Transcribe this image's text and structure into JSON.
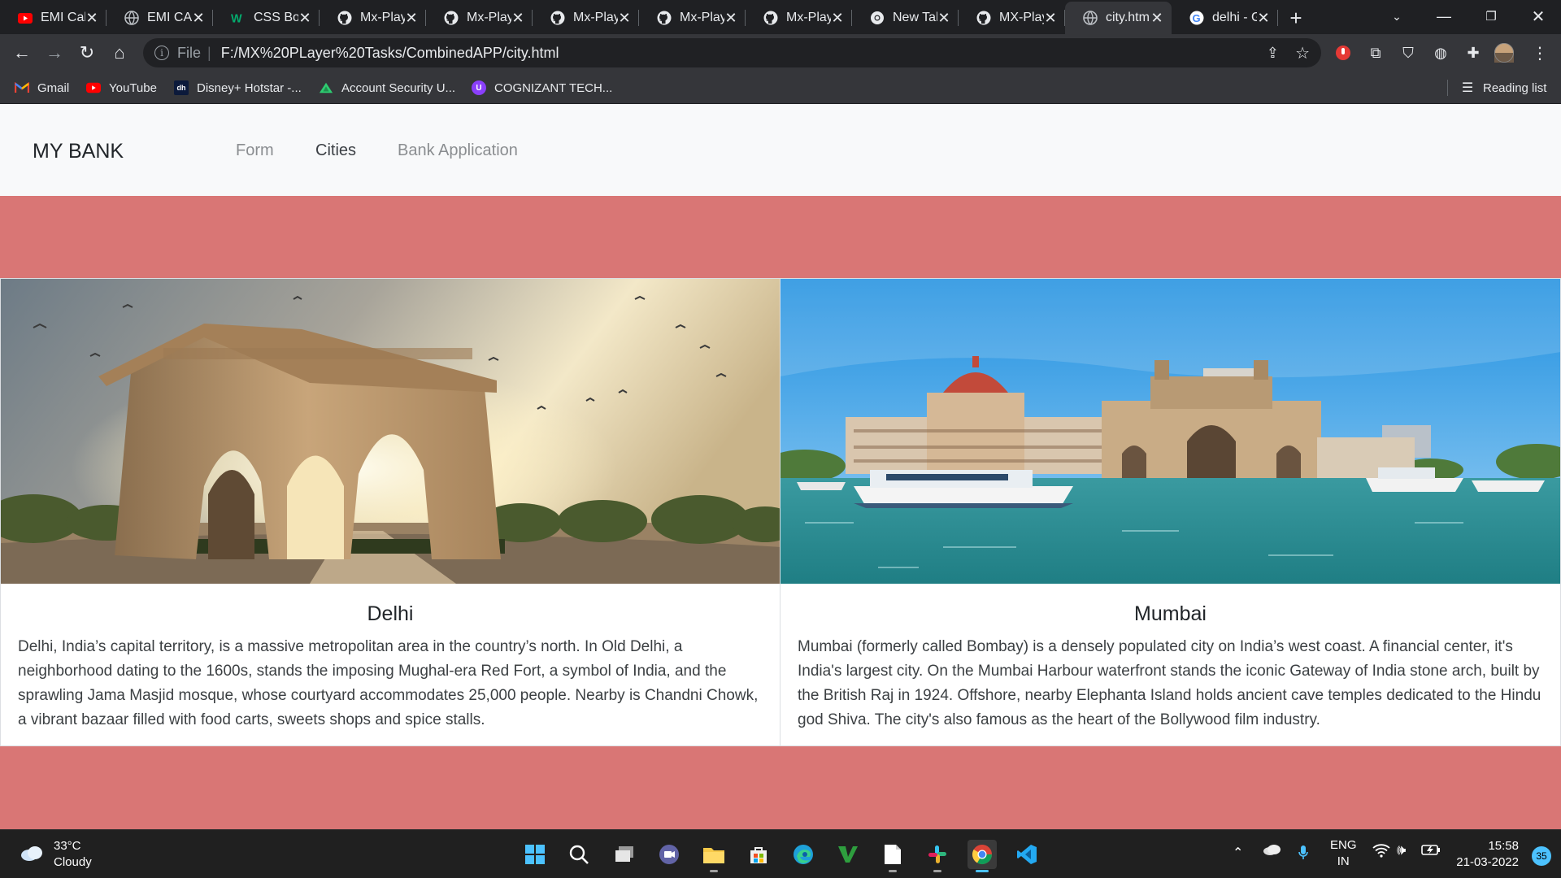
{
  "browser": {
    "tabs": [
      {
        "title": "EMI Cal",
        "icon": "youtube-icon"
      },
      {
        "title": "EMI CA",
        "icon": "globe-icon"
      },
      {
        "title": "CSS Box",
        "icon": "w3schools-icon"
      },
      {
        "title": "Mx-Play",
        "icon": "github-icon"
      },
      {
        "title": "Mx-Play",
        "icon": "github-icon"
      },
      {
        "title": "Mx-Play",
        "icon": "github-icon"
      },
      {
        "title": "Mx-Play",
        "icon": "github-icon"
      },
      {
        "title": "Mx-Play",
        "icon": "github-icon"
      },
      {
        "title": "New Tab",
        "icon": "chrome-icon"
      },
      {
        "title": "MX-Play",
        "icon": "github-icon"
      },
      {
        "title": "city.htm",
        "icon": "globe-icon",
        "active": true
      },
      {
        "title": "delhi - G",
        "icon": "google-icon"
      }
    ],
    "address": {
      "scheme": "File",
      "url": "F:/MX%20PLayer%20Tasks/CombinedAPP/city.html"
    },
    "bookmarks": [
      {
        "label": "Gmail",
        "icon": "gmail-icon"
      },
      {
        "label": "YouTube",
        "icon": "youtube-icon"
      },
      {
        "label": "Disney+ Hotstar -...",
        "icon": "hotstar-icon"
      },
      {
        "label": "Account Security U...",
        "icon": "triangle-icon"
      },
      {
        "label": "COGNIZANT TECH...",
        "icon": "cognizant-icon"
      }
    ],
    "reading_list": "Reading list"
  },
  "site": {
    "brand": "MY BANK",
    "nav": [
      {
        "label": "Form",
        "active": false
      },
      {
        "label": "Cities",
        "active": true
      },
      {
        "label": "Bank Application",
        "active": false
      }
    ],
    "background_color": "#d97675"
  },
  "cards": [
    {
      "title": "Delhi",
      "image": "india-gate-photo",
      "text": "Delhi, India’s capital territory, is a massive metropolitan area in the country’s north. In Old Delhi, a neighborhood dating to the 1600s, stands the imposing Mughal-era Red Fort, a symbol of India, and the sprawling Jama Masjid mosque, whose courtyard accommodates 25,000 people. Nearby is Chandni Chowk, a vibrant bazaar filled with food carts, sweets shops and spice stalls."
    },
    {
      "title": "Mumbai",
      "image": "gateway-of-india-photo",
      "text": "Mumbai (formerly called Bombay) is a densely populated city on India’s west coast. A financial center, it's India's largest city. On the Mumbai Harbour waterfront stands the iconic Gateway of India stone arch, built by the British Raj in 1924. Offshore, nearby Elephanta Island holds ancient cave temples dedicated to the Hindu god Shiva. The city's also famous as the heart of the Bollywood film industry."
    }
  ],
  "taskbar": {
    "weather": {
      "temp": "33°C",
      "condition": "Cloudy"
    },
    "language": {
      "line1": "ENG",
      "line2": "IN"
    },
    "clock": {
      "time": "15:58",
      "date": "21-03-2022"
    },
    "notifications": "35"
  }
}
